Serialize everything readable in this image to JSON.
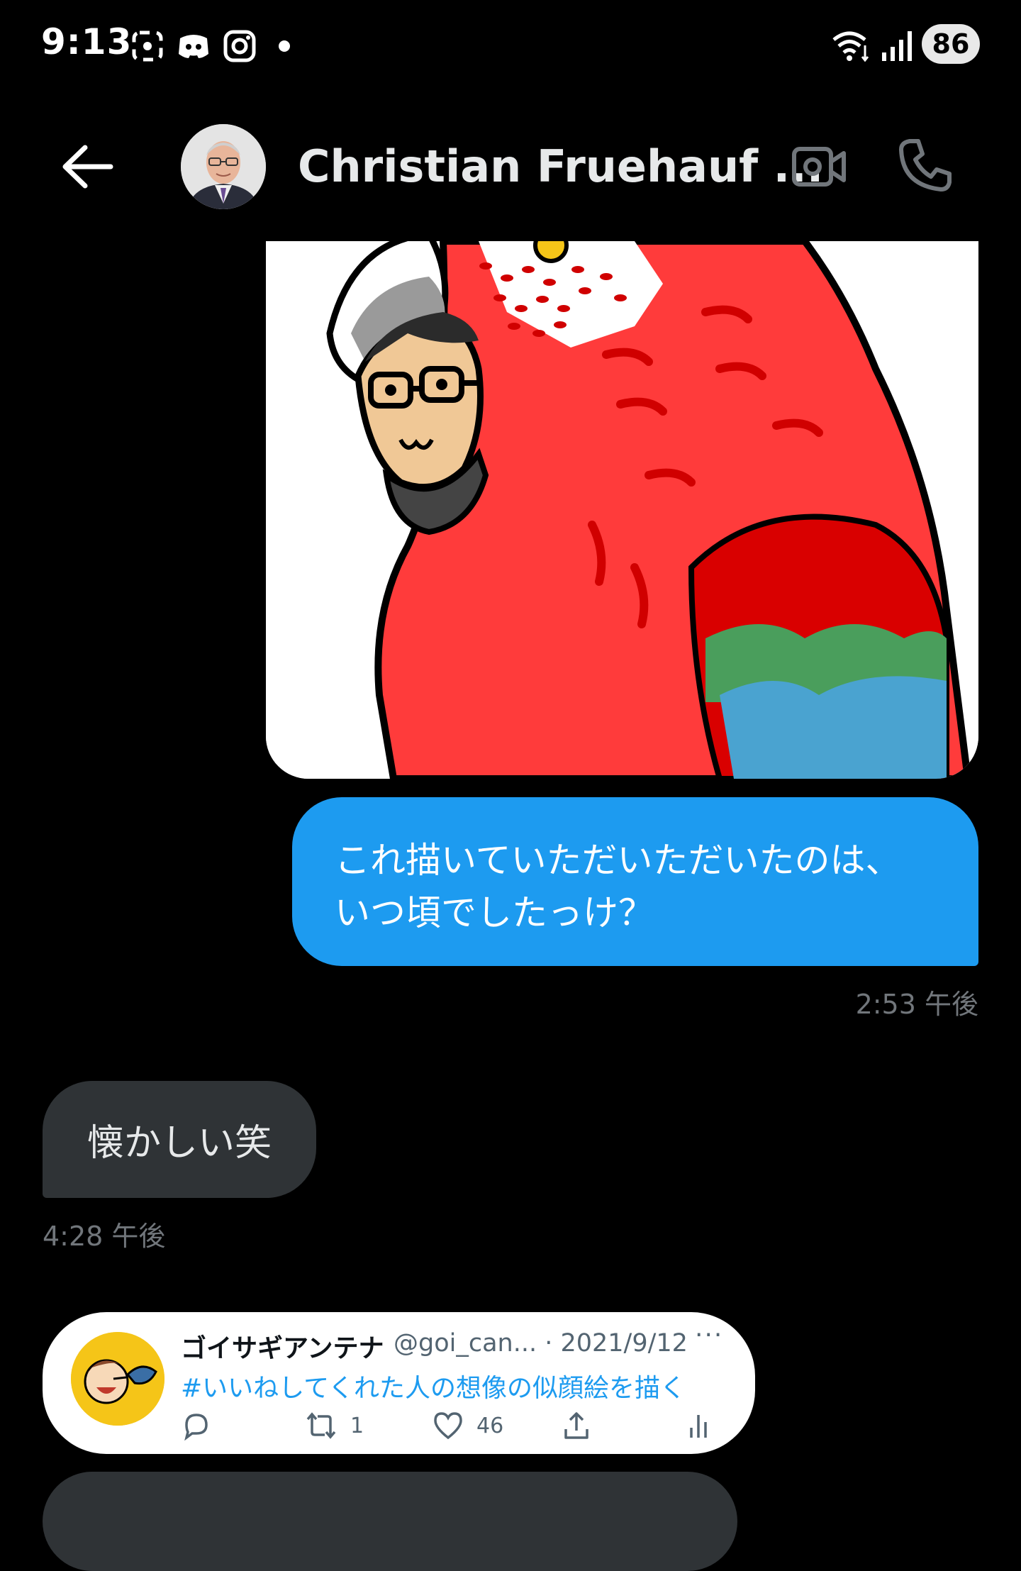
{
  "status_bar": {
    "time": "9:13",
    "battery": "86"
  },
  "header": {
    "contact_name": "Christian Fruehauf ..."
  },
  "messages": {
    "outgoing": {
      "line1": "これ描いていただいただいたのは、",
      "line2": "いつ頃でしたっけ？",
      "time": "2:53 午後"
    },
    "incoming": {
      "text": "懐かしい笑",
      "time": "4:28 午後"
    }
  },
  "tweet": {
    "author": "ゴイサギアンテナ",
    "handle_date": "@goi_can... · 2021/9/12",
    "more": "···",
    "text": "#いいねしてくれた人の想像の似顔絵を描く",
    "retweets": "1",
    "likes": "46"
  },
  "colors": {
    "accent": "#1d9bf0",
    "incoming_bubble": "#2f3336",
    "muted": "#71767b"
  }
}
